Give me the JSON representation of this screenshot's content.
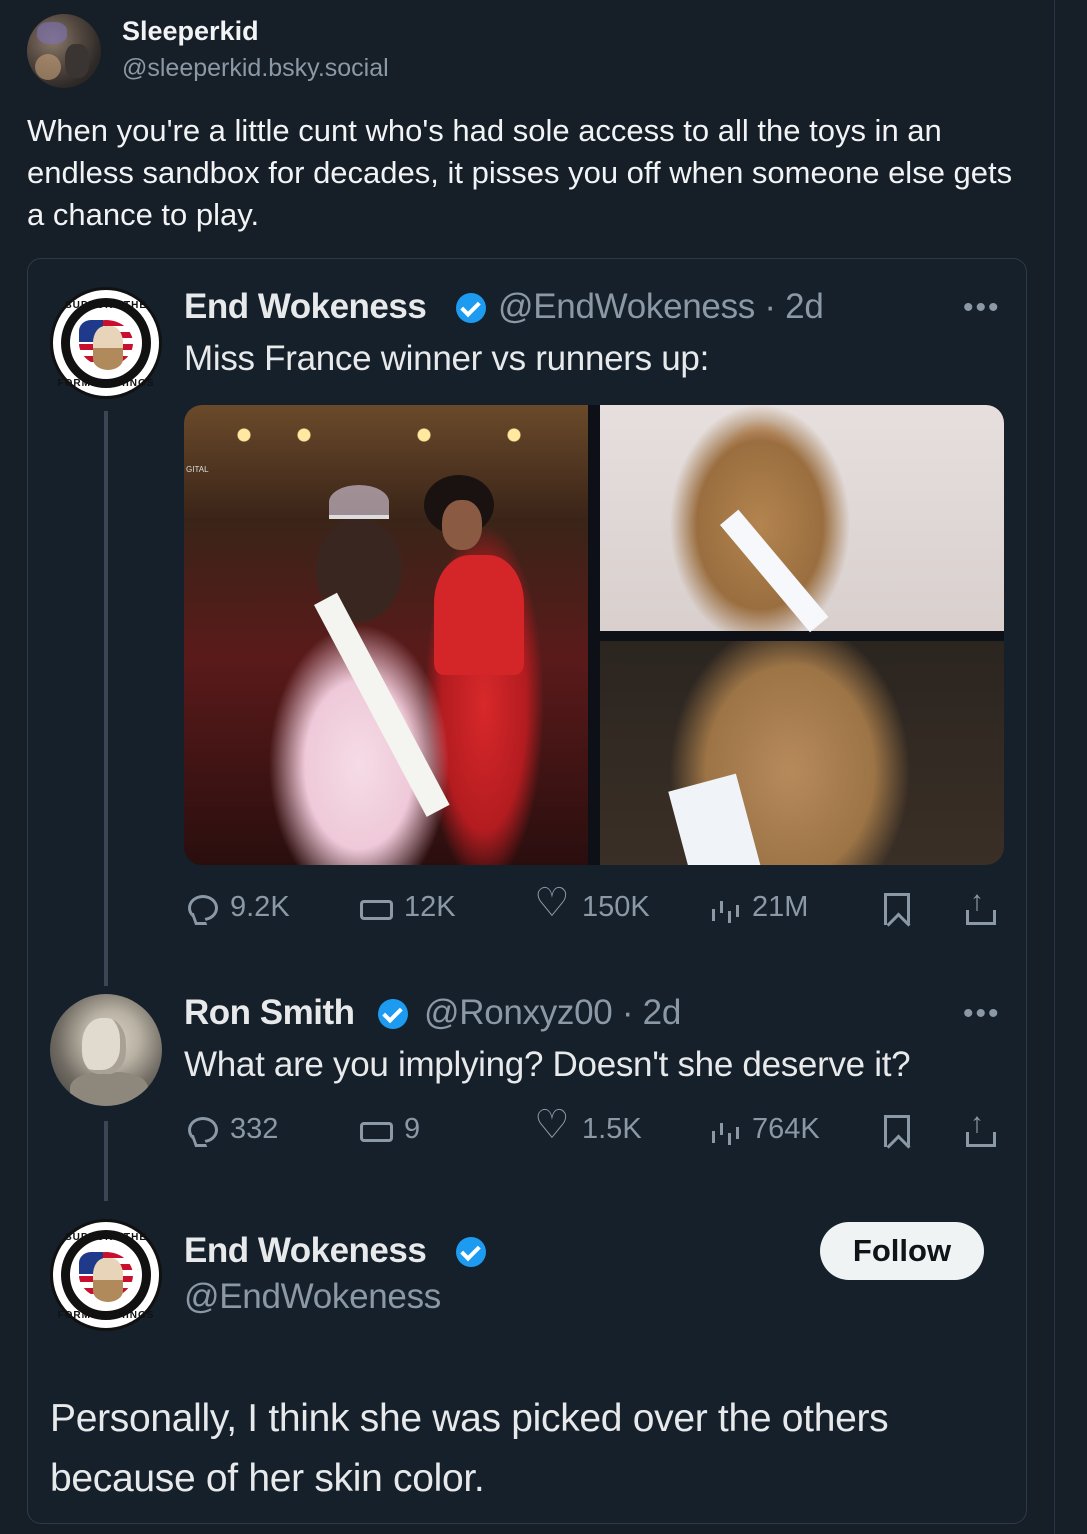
{
  "post": {
    "author_name": "Sleeperkid",
    "author_handle": "@sleeperkid.bsky.social",
    "text": "When you're a little cunt who's had sole access to all the toys in an endless sandbox for decades, it pisses you off when someone else gets a chance to play."
  },
  "embed": {
    "tweet1": {
      "name": "End Wokeness",
      "handle_time": "@EndWokeness · 2d",
      "text": "Miss France winner vs runners up:",
      "more": "•••",
      "image_main_label": "GITAL",
      "stats": {
        "replies": "9.2K",
        "reposts": "12K",
        "likes": "150K",
        "views": "21M"
      }
    },
    "tweet2": {
      "name": "Ron Smith",
      "handle_time": "@Ronxyz00 · 2d",
      "text": "What are you implying? Doesn't she deserve it?",
      "more": "•••",
      "stats": {
        "replies": "332",
        "reposts": "9",
        "likes": "1.5K",
        "views": "764K"
      }
    },
    "tweet3": {
      "name": "End Wokeness",
      "handle": "@EndWokeness",
      "follow_label": "Follow",
      "text": "Personally, I think she was picked over the others because of her skin color."
    },
    "avatar_text": {
      "top": "SUPPORT THE",
      "bottom": "FORMER THINGS"
    },
    "colors": {
      "verified": "#1d9bf0",
      "background": "#15202b",
      "muted": "#8b98a5"
    }
  }
}
